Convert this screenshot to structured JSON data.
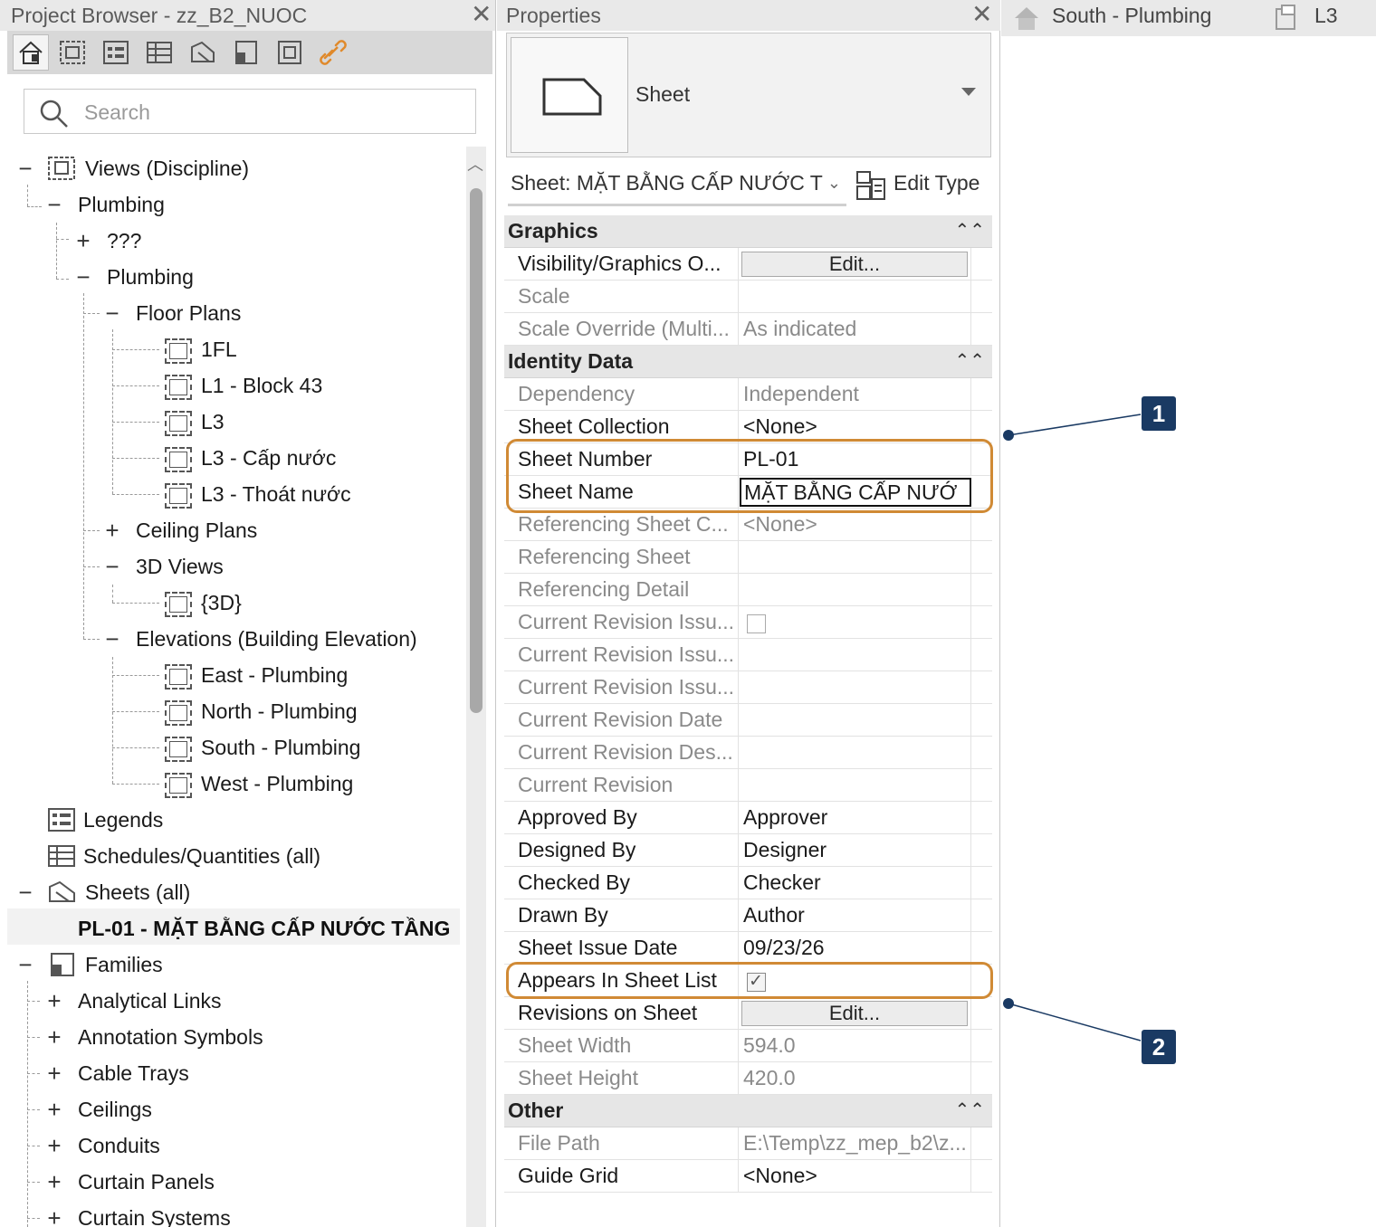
{
  "project_browser": {
    "title": "Project Browser - zz_B2_NUOC",
    "close": "✕",
    "search_placeholder": "Search",
    "tree": {
      "views_discipline": "Views (Discipline)",
      "plumbing_l1": "Plumbing",
      "unknown": "???",
      "plumbing_l2": "Plumbing",
      "floor_plans": "Floor Plans",
      "fp_items": [
        "1FL",
        "L1 - Block 43",
        "L3",
        "L3 - Cấp nước",
        "L3 - Thoát nước"
      ],
      "ceiling_plans": "Ceiling Plans",
      "views_3d": "3D Views",
      "view_3d_item": "{3D}",
      "elevations": "Elevations (Building Elevation)",
      "elev_items": [
        "East - Plumbing",
        "North - Plumbing",
        "South - Plumbing",
        "West - Plumbing"
      ],
      "legends": "Legends",
      "schedules": "Schedules/Quantities (all)",
      "sheets": "Sheets (all)",
      "sheet_item": "PL-01 - MẶT BẰNG CẤP NƯỚC TẦNG",
      "families": "Families",
      "family_items": [
        "Analytical Links",
        "Annotation Symbols",
        "Cable Trays",
        "Ceilings",
        "Conduits",
        "Curtain Panels",
        "Curtain Systems"
      ]
    }
  },
  "properties": {
    "title": "Properties",
    "close": "✕",
    "type_name": "Sheet",
    "instance_selector": "Sheet: MẶT BẰNG CẤP NƯỚC T",
    "edit_type": "Edit Type",
    "groups": {
      "graphics": "Graphics",
      "identity": "Identity Data",
      "other": "Other"
    },
    "graphics_rows": [
      {
        "name": "Visibility/Graphics O...",
        "button": "Edit..."
      },
      {
        "name": "Scale",
        "value": ""
      },
      {
        "name": "Scale Override (Multi...",
        "value": "As indicated"
      }
    ],
    "identity_rows": [
      {
        "name": "Dependency",
        "value": "Independent"
      },
      {
        "name": "Sheet Collection",
        "value": "<None>"
      },
      {
        "name": "Sheet Number",
        "value": "PL-01"
      },
      {
        "name": "Sheet Name",
        "value": "MẶT BẰNG CẤP NƯỚ"
      },
      {
        "name": "Referencing Sheet C...",
        "value": "<None>"
      },
      {
        "name": "Referencing Sheet",
        "value": ""
      },
      {
        "name": "Referencing Detail",
        "value": ""
      },
      {
        "name": "Current Revision Issu...",
        "checkbox": false
      },
      {
        "name": "Current Revision Issu...",
        "value": ""
      },
      {
        "name": "Current Revision Issu...",
        "value": ""
      },
      {
        "name": "Current Revision Date",
        "value": ""
      },
      {
        "name": "Current Revision Des...",
        "value": ""
      },
      {
        "name": "Current Revision",
        "value": ""
      },
      {
        "name": "Approved By",
        "value": "Approver"
      },
      {
        "name": "Designed By",
        "value": "Designer"
      },
      {
        "name": "Checked By",
        "value": "Checker"
      },
      {
        "name": "Drawn By",
        "value": "Author"
      },
      {
        "name": "Sheet Issue Date",
        "value": "09/23/26"
      },
      {
        "name": "Appears In Sheet List",
        "checkbox": true
      },
      {
        "name": "Revisions on Sheet",
        "button": "Edit..."
      },
      {
        "name": "Sheet Width",
        "value": "594.0"
      },
      {
        "name": "Sheet Height",
        "value": "420.0"
      }
    ],
    "other_rows": [
      {
        "name": "File Path",
        "value": "E:\\Temp\\zz_mep_b2\\z..."
      },
      {
        "name": "Guide Grid",
        "value": "<None>"
      }
    ]
  },
  "view_tabs": {
    "tab1": "South - Plumbing",
    "tab2": "L3"
  },
  "callouts": [
    "1",
    "2"
  ],
  "colors": {
    "highlight": "#d08a35",
    "callout": "#1a3a63"
  }
}
